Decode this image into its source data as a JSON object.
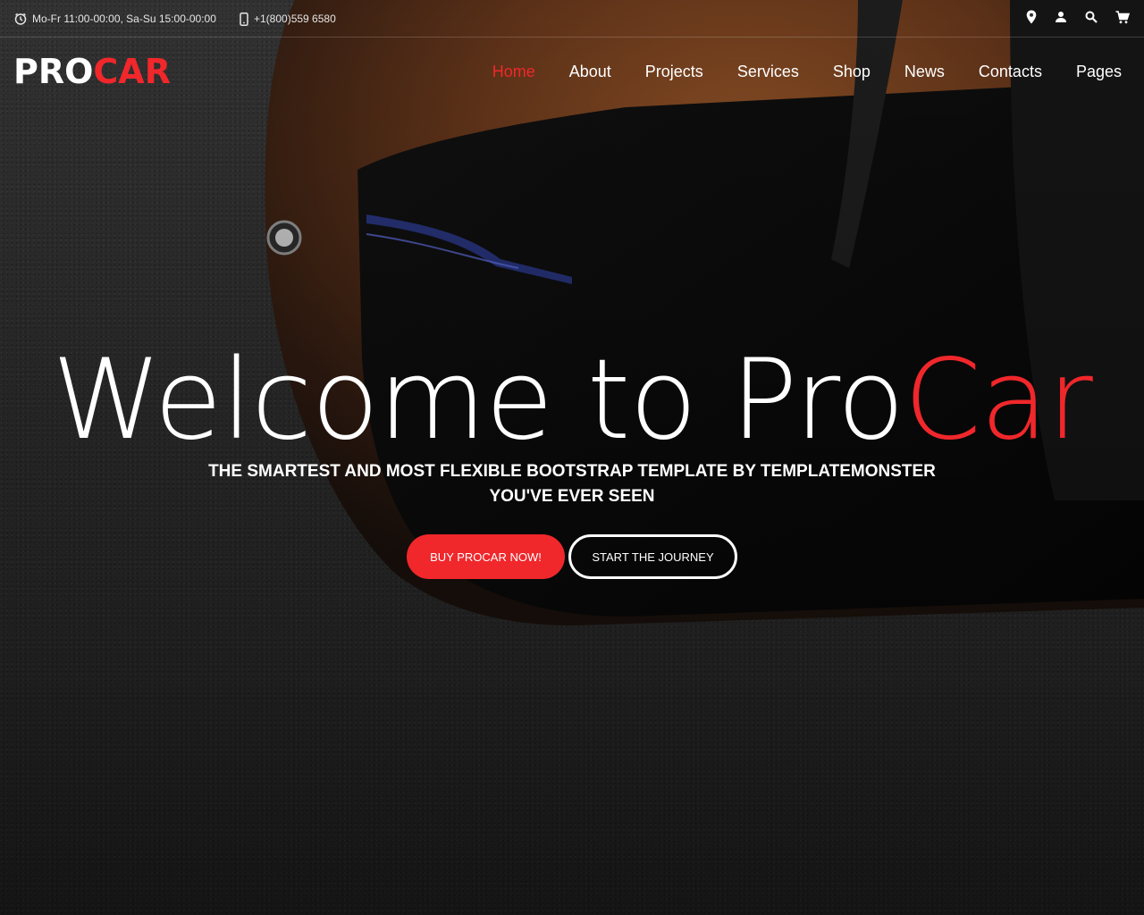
{
  "topbar": {
    "hours": "Mo-Fr 11:00-00:00, Sa-Su 15:00-00:00",
    "phone": "+1(800)559 6580",
    "icons": [
      "location-pin-icon",
      "user-icon",
      "search-icon",
      "cart-icon"
    ]
  },
  "header": {
    "logo_part1": "PRO",
    "logo_part2": "CAR",
    "nav": [
      "Home",
      "About",
      "Projects",
      "Services",
      "Shop",
      "News",
      "Contacts",
      "Pages"
    ],
    "active_nav": "Home"
  },
  "hero": {
    "title_part1": "Welcome to Pro",
    "title_part2": "Car",
    "subtitle_line1": "THE SMARTEST AND MOST FLEXIBLE BOOTSTRAP TEMPLATE BY TEMPLATEMONSTER",
    "subtitle_line2": "YOU'VE EVER SEEN",
    "primary_button": "BUY PROCAR NOW!",
    "secondary_button": "START THE JOURNEY"
  },
  "colors": {
    "accent": "#f0272b",
    "text": "#ffffff",
    "background": "#2e2e2e",
    "car_body": "#6b3a1c"
  }
}
